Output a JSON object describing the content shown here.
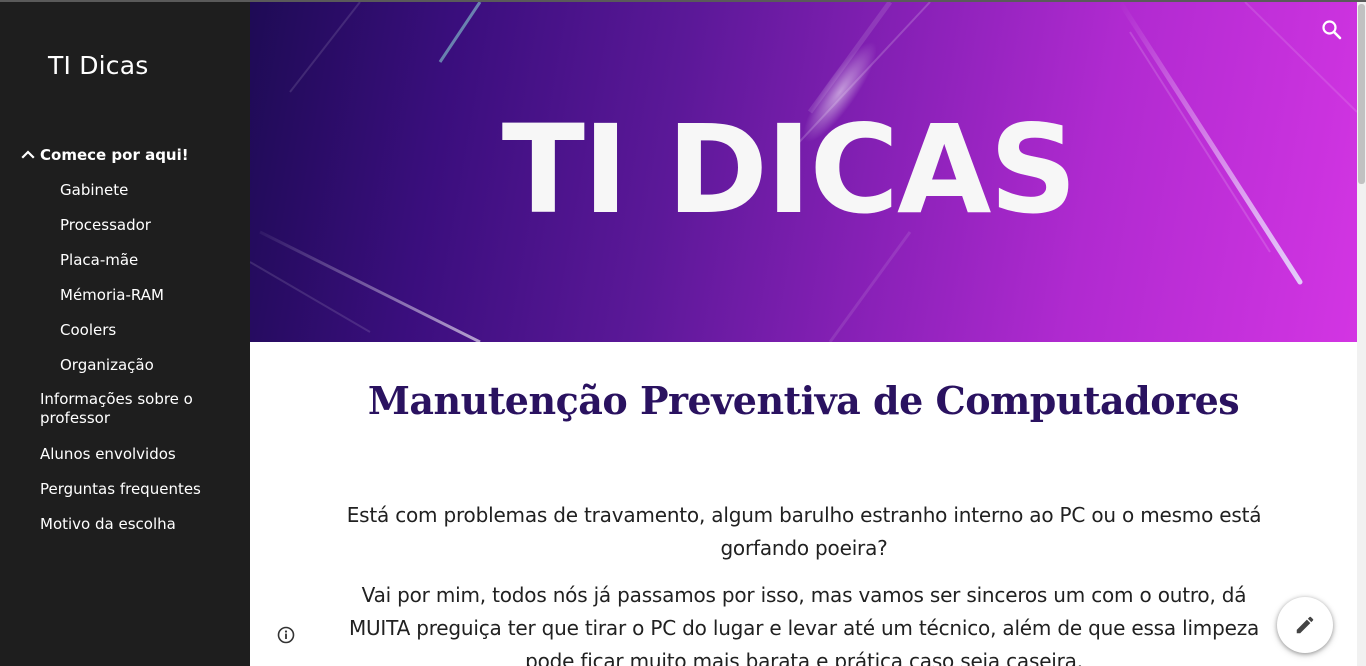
{
  "site": {
    "title": "TI Dicas"
  },
  "sidebar": {
    "items": [
      {
        "label": "Comece por aqui!",
        "expanded": true
      },
      {
        "label": "Gabinete"
      },
      {
        "label": "Processador"
      },
      {
        "label": "Placa-mãe"
      },
      {
        "label": "Mémoria-RAM"
      },
      {
        "label": "Coolers"
      },
      {
        "label": "Organização"
      },
      {
        "label": "Informações sobre o professor"
      },
      {
        "label": "Alunos envolvidos"
      },
      {
        "label": "Perguntas frequentes"
      },
      {
        "label": "Motivo da escolha"
      }
    ]
  },
  "hero": {
    "banner_text": "TI DICAS"
  },
  "main": {
    "heading": "Manutenção Preventiva de Computadores",
    "paragraphs": [
      "Está com problemas de travamento, algum barulho estranho interno ao PC ou o mesmo está gorfando poeira?",
      "Vai por mim, todos nós já passamos por isso, mas vamos ser sinceros um com o outro, dá MUITA preguiça ter que tirar o PC do lugar e levar até um técnico, além de que essa limpeza pode ficar muito mais barata e prática caso seja caseira."
    ]
  },
  "icons": {
    "search": "search-icon",
    "info": "info-icon",
    "edit": "edit-pencil-icon",
    "expand": "chevron-up-icon"
  },
  "colors": {
    "sidebar_bg": "#1e1e1e",
    "heading": "#2a1260",
    "hero_start": "#1e0b55",
    "hero_end": "#d335e3"
  }
}
